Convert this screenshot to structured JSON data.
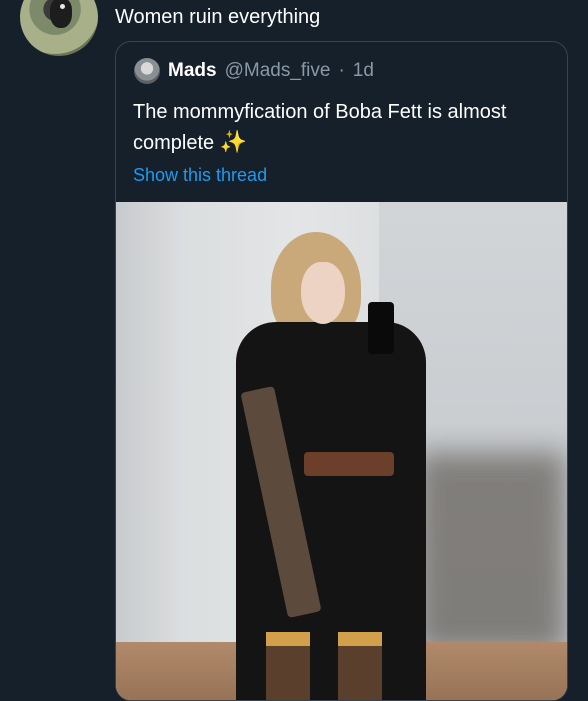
{
  "tweet": {
    "text": "Women ruin everything"
  },
  "quoted_tweet": {
    "author_name": "Mads",
    "author_handle": "@Mads_five",
    "separator": "·",
    "time": "1d",
    "body": "The mommyfication of Boba Fett is almost complete",
    "emoji": "✨",
    "show_thread_label": "Show this thread"
  }
}
